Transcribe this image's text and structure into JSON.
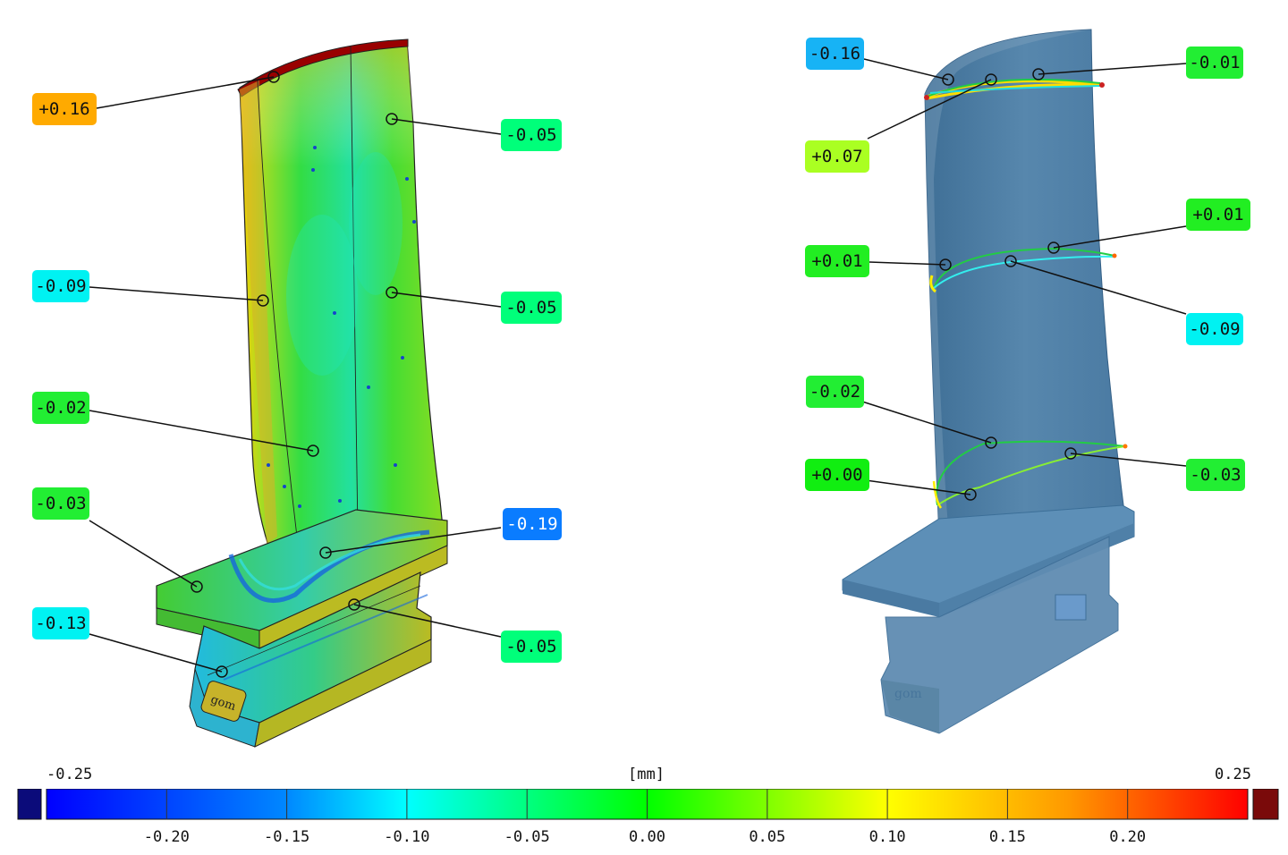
{
  "colors": {
    "green": "#00ff55",
    "bright_green": "#22ee22",
    "cyan": "#00eeee",
    "orange": "#ffaa00",
    "blue": "#0a7cff",
    "sky": "#17b3f5",
    "lime": "#aaff22",
    "part_overlay": "#4a7ea6"
  },
  "left_view": {
    "labels": [
      {
        "id": "l1",
        "text": "+0.16",
        "color": "#ffaa00"
      },
      {
        "id": "l2",
        "text": "-0.05",
        "color": "#00ff7a"
      },
      {
        "id": "l3",
        "text": "-0.09",
        "color": "#00f2f2"
      },
      {
        "id": "l4",
        "text": "-0.05",
        "color": "#00ff7a"
      },
      {
        "id": "l5",
        "text": "-0.02",
        "color": "#22ee33"
      },
      {
        "id": "l6",
        "text": "-0.03",
        "color": "#22ee33"
      },
      {
        "id": "l7",
        "text": "-0.19",
        "color": "#0a7cff"
      },
      {
        "id": "l8",
        "text": "-0.13",
        "color": "#00f2f2"
      },
      {
        "id": "l9",
        "text": "-0.05",
        "color": "#00ff7a"
      }
    ]
  },
  "right_view": {
    "labels": [
      {
        "id": "r1",
        "text": "-0.16",
        "color": "#17b3f5"
      },
      {
        "id": "r2",
        "text": "-0.01",
        "color": "#22ee33"
      },
      {
        "id": "r3",
        "text": "+0.07",
        "color": "#aaff22"
      },
      {
        "id": "r4",
        "text": "+0.01",
        "color": "#22ee22"
      },
      {
        "id": "r5",
        "text": "+0.01",
        "color": "#22ee22"
      },
      {
        "id": "r6",
        "text": "-0.09",
        "color": "#00f2f2"
      },
      {
        "id": "r7",
        "text": "-0.02",
        "color": "#22ee33"
      },
      {
        "id": "r8",
        "text": "-0.03",
        "color": "#22ee33"
      },
      {
        "id": "r9",
        "text": "+0.00",
        "color": "#11ee11"
      }
    ]
  },
  "legend": {
    "unit": "[mm]",
    "min_label": "-0.25",
    "max_label": "0.25",
    "ticks": [
      "-0.20",
      "-0.15",
      "-0.10",
      "-0.05",
      "0.00",
      "0.05",
      "0.10",
      "0.15",
      "0.20"
    ],
    "under_color": "#0b0b7a",
    "over_color": "#7a0a0a"
  }
}
